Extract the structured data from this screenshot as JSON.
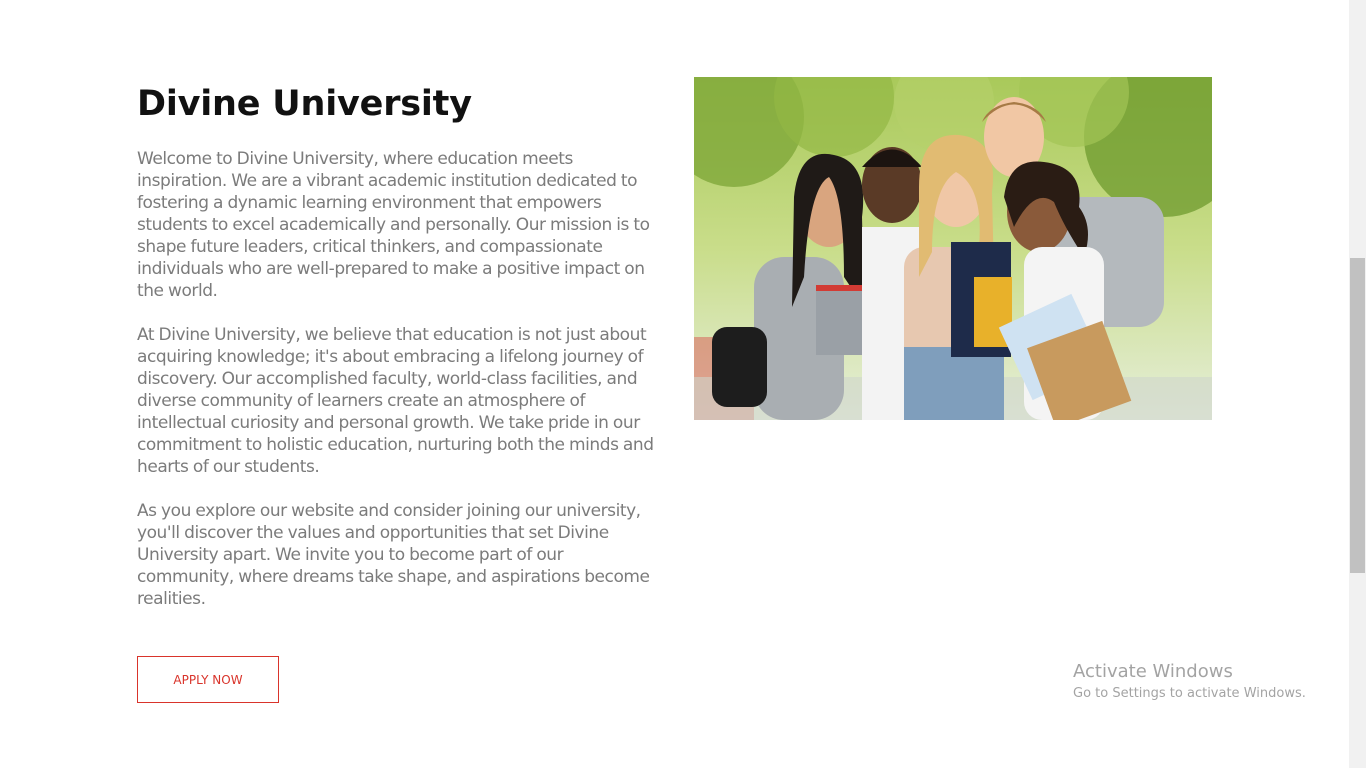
{
  "page": {
    "title": "Divine University",
    "paragraphs": [
      "Welcome to Divine University, where education meets inspiration. We are a vibrant academic institution dedicated to fostering a dynamic learning environment that empowers students to excel academically and personally. Our mission is to shape future leaders, critical thinkers, and compassionate individuals who are well-prepared to make a positive impact on the world.",
      "At Divine University, we believe that education is not just about acquiring knowledge; it's about embracing a lifelong journey of discovery. Our accomplished faculty, world-class facilities, and diverse community of learners create an atmosphere of intellectual curiosity and personal growth. We take pride in our commitment to holistic education, nurturing both the minds and hearts of our students.",
      "As you explore our website and consider joining our university, you'll discover the values and opportunities that set Divine University apart. We invite you to become part of our community, where dreams take shape, and aspirations become realities."
    ],
    "apply_label": "APPLY NOW",
    "accent_color": "#d9342b",
    "image_icon": "students-group-photo"
  },
  "watermark": {
    "title": "Activate Windows",
    "subtitle": "Go to Settings to activate Windows."
  }
}
